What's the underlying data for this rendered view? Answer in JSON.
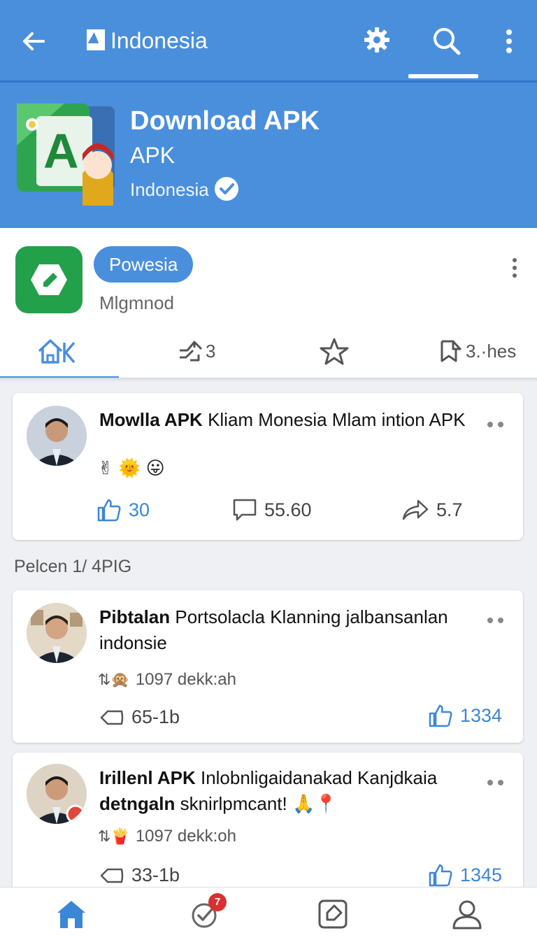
{
  "appbar": {
    "title": "Indonesia"
  },
  "banner": {
    "title": "Download APK",
    "subtitle": "APK",
    "country": "Indonesia"
  },
  "profile": {
    "chip": "Powesia",
    "handle": "Mlgmnod",
    "tabs": [
      {
        "label": "",
        "icon": "home-icon"
      },
      {
        "label": "3",
        "icon": "share-icon"
      },
      {
        "label": "",
        "icon": "star-icon"
      },
      {
        "label": "3.·hes",
        "icon": "bookmark-icon"
      }
    ]
  },
  "posts": [
    {
      "author": "Mowlla APK",
      "text": "Kliam Monesia Mlam intion APK",
      "emojis": "✌ 🌞 😛",
      "likes": "30",
      "comments": "55.60",
      "shares": "5.7"
    },
    {
      "author": "Pibtalan",
      "text": "Portsolacla Klanning jalbansanlan indonsie",
      "meta": "1097 dekk:ah",
      "replies": "65-1b",
      "likes": "1334"
    },
    {
      "author": "Irillenl APK",
      "text": "Inlobnligaidanakad Kanjdkaia",
      "text_bold": "detngaln",
      "text_tail": "sknirlpmcant!",
      "meta": "1097 dekk:oh",
      "replies": "33-1b",
      "likes": "1345"
    }
  ],
  "section_label": "Pelcen 1/ 4PIG",
  "bottomnav": {
    "badge": "7"
  },
  "colors": {
    "primary": "#4a8fdc",
    "accent_green": "#23a04a",
    "badge_red": "#d93030"
  }
}
